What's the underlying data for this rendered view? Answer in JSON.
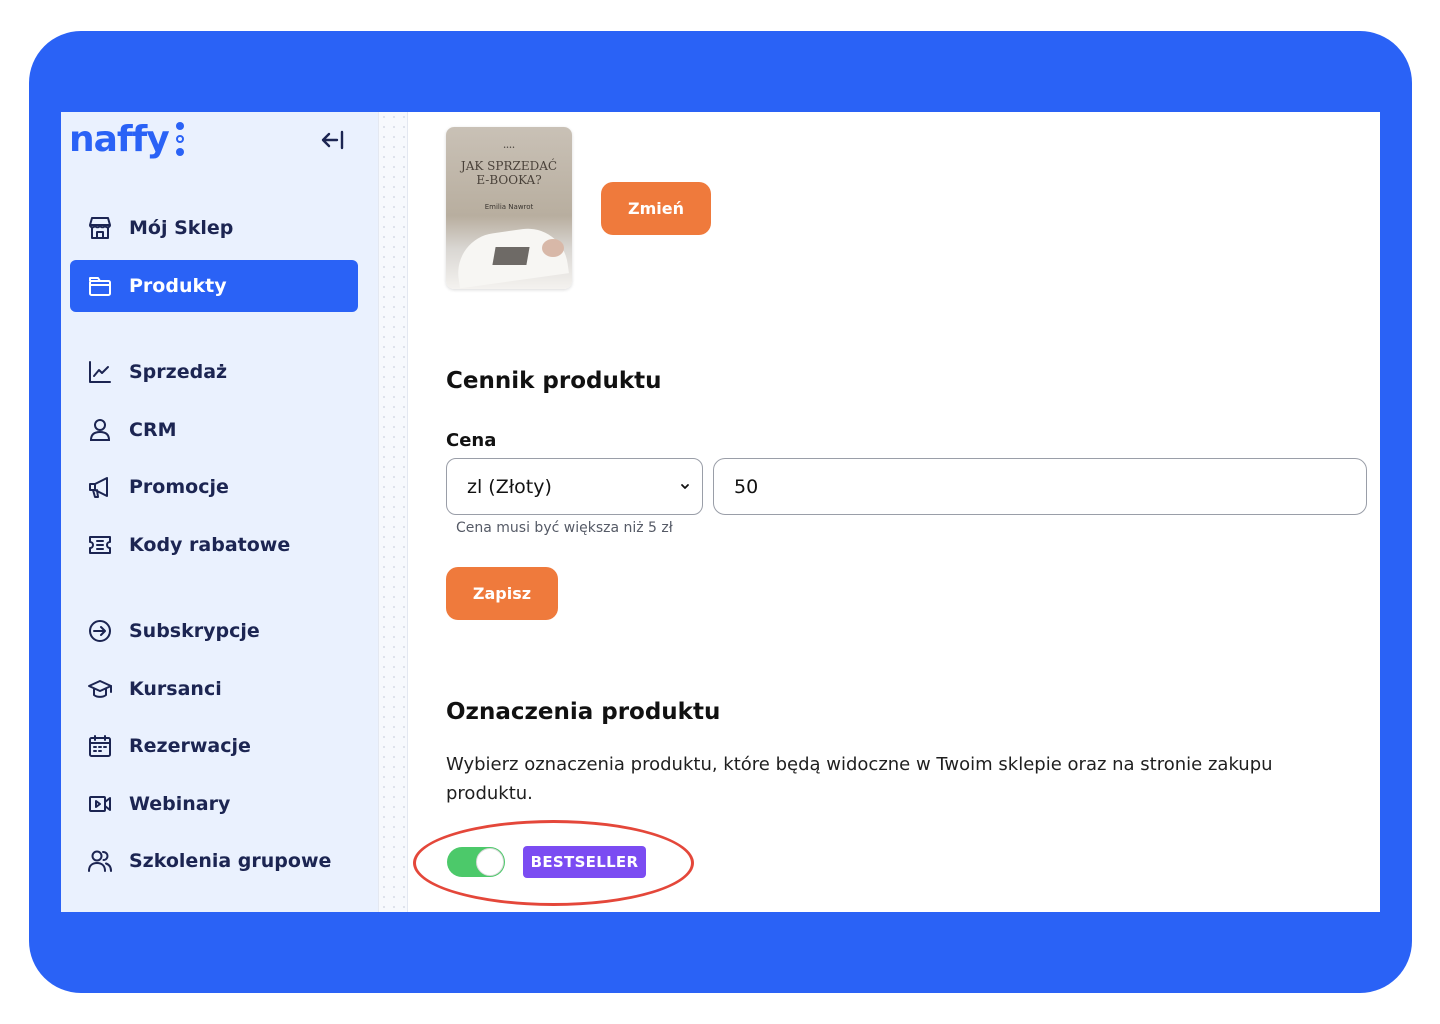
{
  "sidebar": {
    "logo": "naffy",
    "items": [
      {
        "label": "Mój Sklep",
        "icon": "store-icon"
      },
      {
        "label": "Produkty",
        "icon": "folder-icon",
        "active": true
      },
      {
        "label": "Sprzedaż",
        "icon": "chart-line-icon"
      },
      {
        "label": "CRM",
        "icon": "user-icon"
      },
      {
        "label": "Promocje",
        "icon": "megaphone-icon"
      },
      {
        "label": "Kody rabatowe",
        "icon": "ticket-icon"
      },
      {
        "label": "Subskrypcje",
        "icon": "arrow-circle-icon"
      },
      {
        "label": "Kursanci",
        "icon": "graduation-cap-icon"
      },
      {
        "label": "Rezerwacje",
        "icon": "calendar-icon"
      },
      {
        "label": "Webinary",
        "icon": "video-icon"
      },
      {
        "label": "Szkolenia grupowe",
        "icon": "users-icon"
      }
    ]
  },
  "product_image": {
    "cover_small": "••••",
    "cover_title_line1": "JAK SPRZEDAĆ",
    "cover_title_line2": "E-BOOKA?",
    "cover_author": "Emilia Nawrot",
    "change_label": "Zmień"
  },
  "pricing": {
    "title": "Cennik produktu",
    "price_label": "Cena",
    "currency": "zl (Złoty)",
    "price_value": "50",
    "helper": "Cena musi być większa niż 5 zł",
    "save_label": "Zapisz"
  },
  "badges": {
    "title": "Oznaczenia produktu",
    "description": "Wybierz oznaczenia produktu, które będą widoczne w Twoim sklepie oraz na stronie zakupu produktu.",
    "bestseller_label": "BESTSELLER",
    "bestseller_enabled": true
  },
  "colors": {
    "brand_blue": "#2a62f6",
    "orange": "#ef7a3c",
    "toggle_green": "#4cc96a",
    "badge_purple": "#7b4cf2",
    "highlight_red": "#e4473a"
  }
}
